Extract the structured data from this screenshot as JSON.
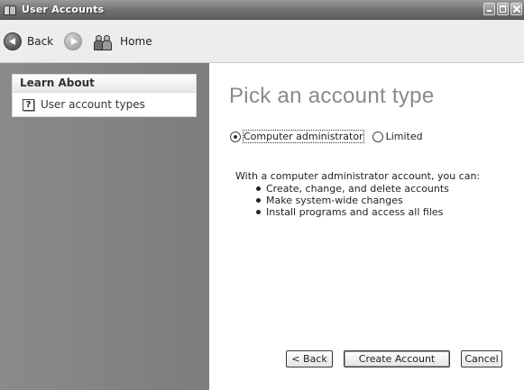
{
  "window": {
    "title": "User Accounts"
  },
  "toolbar": {
    "back_label": "Back",
    "home_label": "Home"
  },
  "sidebar": {
    "heading": "Learn About",
    "items": [
      {
        "label": "User account types",
        "icon": "help-icon"
      }
    ]
  },
  "main": {
    "title": "Pick an account type",
    "options": [
      {
        "label": "Computer administrator",
        "selected": true
      },
      {
        "label": "Limited",
        "selected": false
      }
    ],
    "description_intro": "With a computer administrator account, you can:",
    "bullets": [
      "Create, change, and delete accounts",
      "Make system-wide changes",
      "Install programs and access all files"
    ]
  },
  "buttons": {
    "back": "< Back",
    "create": "Create Account",
    "cancel": "Cancel"
  }
}
